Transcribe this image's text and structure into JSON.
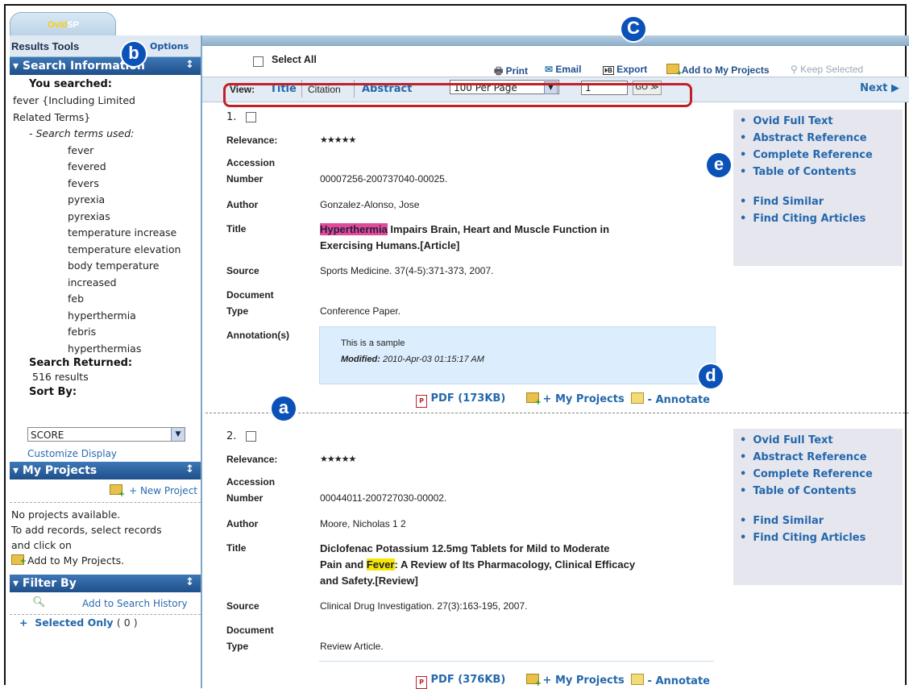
{
  "app": {
    "tab_brand_prefix": "Ovid",
    "tab_brand_suffix": "SP"
  },
  "badges": {
    "a": "a",
    "b": "b",
    "c": "C",
    "d": "d",
    "e": "e"
  },
  "left": {
    "results_tools": "Results Tools",
    "options": "Options",
    "search_info": {
      "header": "Search Information",
      "you_searched_label": "You searched:",
      "query_line1": "fever {Including Limited",
      "query_line2": "Related Terms}",
      "terms_label": "- Search terms used:",
      "terms": [
        "fever",
        "fevered",
        "fevers",
        "pyrexia",
        "pyrexias",
        "temperature increase",
        "temperature elevation",
        "body temperature",
        "increased",
        "feb",
        "hyperthermia",
        "febris",
        "hyperthermias"
      ],
      "returned_label": "Search Returned:",
      "returned_value": "516 results",
      "sort_label": "Sort By:",
      "sort_value": "SCORE",
      "customize": "Customize Display"
    },
    "projects": {
      "header": "My Projects",
      "new_project": "+ New Project",
      "line1": "No projects available.",
      "line2": "To add records, select records",
      "line3": "and click on",
      "line4": "Add to My Projects."
    },
    "filter": {
      "header": "Filter By",
      "add_history": "Add to Search History",
      "selected_only": "Selected Only",
      "selected_count": "( 0 )"
    }
  },
  "toolbar": {
    "select_all": "Select All",
    "print": "Print",
    "email": "Email",
    "export": "Export",
    "add_projects": "Add to My Projects",
    "keep_selected": "Keep Selected"
  },
  "viewbar": {
    "view_label": "View:",
    "title": "Title",
    "citation": "Citation",
    "abstract": "Abstract",
    "per_page": "100 Per Page",
    "page_value": "1",
    "go": "GO ≫",
    "next": "Next ▶"
  },
  "labels": {
    "relevance": "Relevance:",
    "accession1": "Accession",
    "accession2": "Number",
    "author": "Author",
    "title": "Title",
    "source": "Source",
    "doctype1": "Document",
    "doctype2": "Type",
    "annotations": "Annotation(s)"
  },
  "right_links": {
    "full_text": "Ovid Full Text",
    "abstract_ref": "Abstract Reference",
    "complete_ref": "Complete Reference",
    "toc": "Table of Contents",
    "similar": "Find Similar",
    "citing": "Find Citing Articles"
  },
  "records": [
    {
      "num": "1.",
      "stars": "★★★★★",
      "accession": "00007256-200737040-00025.",
      "author": "Gonzalez-Alonso, Jose",
      "title_hl": "Hyperthermia",
      "title_rest1": " Impairs Brain, Heart and Muscle Function in",
      "title_rest2": "Exercising Humans.[Article]",
      "source": "Sports Medicine. 37(4-5):371-373, 2007.",
      "doctype": "Conference Paper.",
      "annotation_text": "This is a sample",
      "annotation_modified_label": "Modified:",
      "annotation_modified_value": " 2010-Apr-03 01:15:17 AM",
      "pdf": "PDF (173KB)",
      "projects": "+ My Projects",
      "annotate": "- Annotate"
    },
    {
      "num": "2.",
      "stars": "★★★★★",
      "accession": "00044011-200727030-00002.",
      "author": "Moore, Nicholas 1 2",
      "title_l1": "Diclofenac Potassium 12.5mg Tablets for Mild to Moderate",
      "title_l2_pre": "Pain and ",
      "title_hl": "Fever",
      "title_l2_post": ": A Review of Its Pharmacology, Clinical Efficacy",
      "title_l3": "and Safety.[Review]",
      "source": "Clinical Drug Investigation. 27(3):163-195, 2007.",
      "doctype": "Review Article.",
      "pdf": "PDF (376KB)",
      "projects": "+ My Projects",
      "annotate": "- Annotate"
    }
  ]
}
